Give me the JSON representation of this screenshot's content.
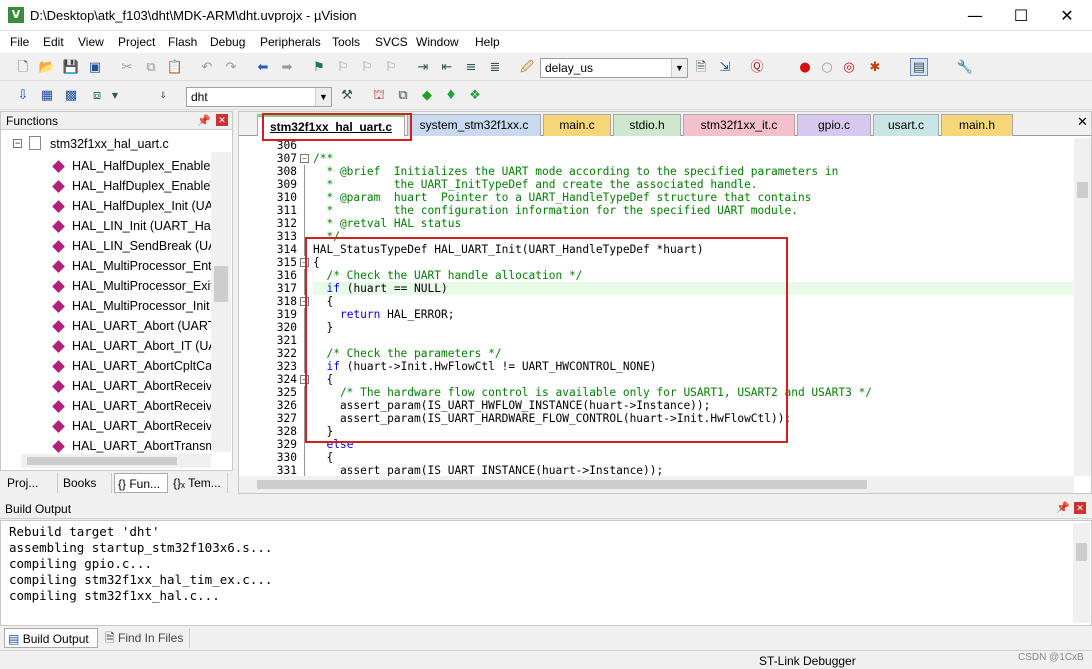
{
  "window": {
    "title": "D:\\Desktop\\atk_f103\\dht\\MDK-ARM\\dht.uvprojx - µVision",
    "minimize": "—",
    "maximize": "☐",
    "close": "✕"
  },
  "menu": [
    "File",
    "Edit",
    "View",
    "Project",
    "Flash",
    "Debug",
    "Peripherals",
    "Tools",
    "SVCS",
    "Window",
    "Help"
  ],
  "toolbar": {
    "find_combo": "delay_us",
    "target_combo": "dht"
  },
  "functions_panel": {
    "title": "Functions",
    "root": "stm32f1xx_hal_uart.c",
    "items": [
      "HAL_HalfDuplex_EnableR",
      "HAL_HalfDuplex_EnableT",
      "HAL_HalfDuplex_Init (UA",
      "HAL_LIN_Init (UART_Han",
      "HAL_LIN_SendBreak (UA",
      "HAL_MultiProcessor_Ent",
      "HAL_MultiProcessor_Exit",
      "HAL_MultiProcessor_Init",
      "HAL_UART_Abort (UART",
      "HAL_UART_Abort_IT (UA",
      "HAL_UART_AbortCpltCal",
      "HAL_UART_AbortReceive",
      "HAL_UART_AbortReceive",
      "HAL_UART_AbortReceive",
      "HAL_UART_AbortTransm"
    ],
    "tabs": [
      "Proj...",
      "Books",
      "{} Fun...",
      "{}ₓ Tem..."
    ]
  },
  "file_tabs": [
    {
      "label": "stm32f1xx_hal_uart.c",
      "color": "#7ed37e",
      "active": true
    },
    {
      "label": "system_stm32f1xx.c",
      "color": "#c9d9ef"
    },
    {
      "label": "main.c",
      "color": "#f5d77a"
    },
    {
      "label": "stdio.h",
      "color": "#cde8cd"
    },
    {
      "label": "stm32f1xx_it.c",
      "color": "#f4c0cc"
    },
    {
      "label": "gpio.c",
      "color": "#d8c8f0"
    },
    {
      "label": "usart.c",
      "color": "#c8e4e4"
    },
    {
      "label": "main.h",
      "color": "#f5d77a"
    }
  ],
  "code_lines": [
    {
      "n": "306",
      "t": ""
    },
    {
      "n": "307",
      "t": "/**",
      "c": "cm"
    },
    {
      "n": "308",
      "t": "  * @brief  Initializes the UART mode according to the specified parameters in",
      "c": "cm"
    },
    {
      "n": "309",
      "t": "  *         the UART_InitTypeDef and create the associated handle.",
      "c": "cm"
    },
    {
      "n": "310",
      "t": "  * @param  huart  Pointer to a UART_HandleTypeDef structure that contains",
      "c": "cm"
    },
    {
      "n": "311",
      "t": "  *         the configuration information for the specified UART module.",
      "c": "cm"
    },
    {
      "n": "312",
      "t": "  * @retval HAL status",
      "c": "cm"
    },
    {
      "n": "313",
      "t": "  */",
      "c": "cm"
    },
    {
      "n": "314",
      "t": "HAL_StatusTypeDef HAL_UART_Init(UART_HandleTypeDef *huart)"
    },
    {
      "n": "315",
      "t": "{"
    },
    {
      "n": "316",
      "t": "  /* Check the UART handle allocation */",
      "c": "cm"
    },
    {
      "n": "317",
      "t": "  if (huart == NULL)",
      "kw": "if"
    },
    {
      "n": "318",
      "t": "  {"
    },
    {
      "n": "319",
      "t": "    return HAL_ERROR;",
      "kw": "return"
    },
    {
      "n": "320",
      "t": "  }"
    },
    {
      "n": "321",
      "t": ""
    },
    {
      "n": "322",
      "t": "  /* Check the parameters */",
      "c": "cm"
    },
    {
      "n": "323",
      "t": "  if (huart->Init.HwFlowCtl != UART_HWCONTROL_NONE)",
      "kw": "if"
    },
    {
      "n": "324",
      "t": "  {"
    },
    {
      "n": "325",
      "t": "    /* The hardware flow control is available only for USART1, USART2 and USART3 */",
      "c": "cm"
    },
    {
      "n": "326",
      "t": "    assert_param(IS_UART_HWFLOW_INSTANCE(huart->Instance));"
    },
    {
      "n": "327",
      "t": "    assert_param(IS_UART_HARDWARE_FLOW_CONTROL(huart->Init.HwFlowCtl));"
    },
    {
      "n": "328",
      "t": "  }"
    },
    {
      "n": "329",
      "t": "  else",
      "kw": "else"
    },
    {
      "n": "330",
      "t": "  {"
    },
    {
      "n": "331",
      "t": "    assert_param(IS_UART_INSTANCE(huart->Instance));"
    }
  ],
  "build_output": {
    "title": "Build Output",
    "lines": [
      "Rebuild target 'dht'",
      "assembling startup_stm32f103x6.s...",
      "compiling gpio.c...",
      "compiling stm32f1xx_hal_tim_ex.c...",
      "compiling stm32f1xx_hal.c..."
    ],
    "tabs": [
      "Build Output",
      "Find In Files"
    ]
  },
  "status": {
    "debugger": "ST-Link Debugger",
    "watermark": "CSDN @1CxB"
  },
  "colors": {
    "highlight_box": "#d02020",
    "comment": "#008000",
    "keyword": "#0000ff"
  }
}
